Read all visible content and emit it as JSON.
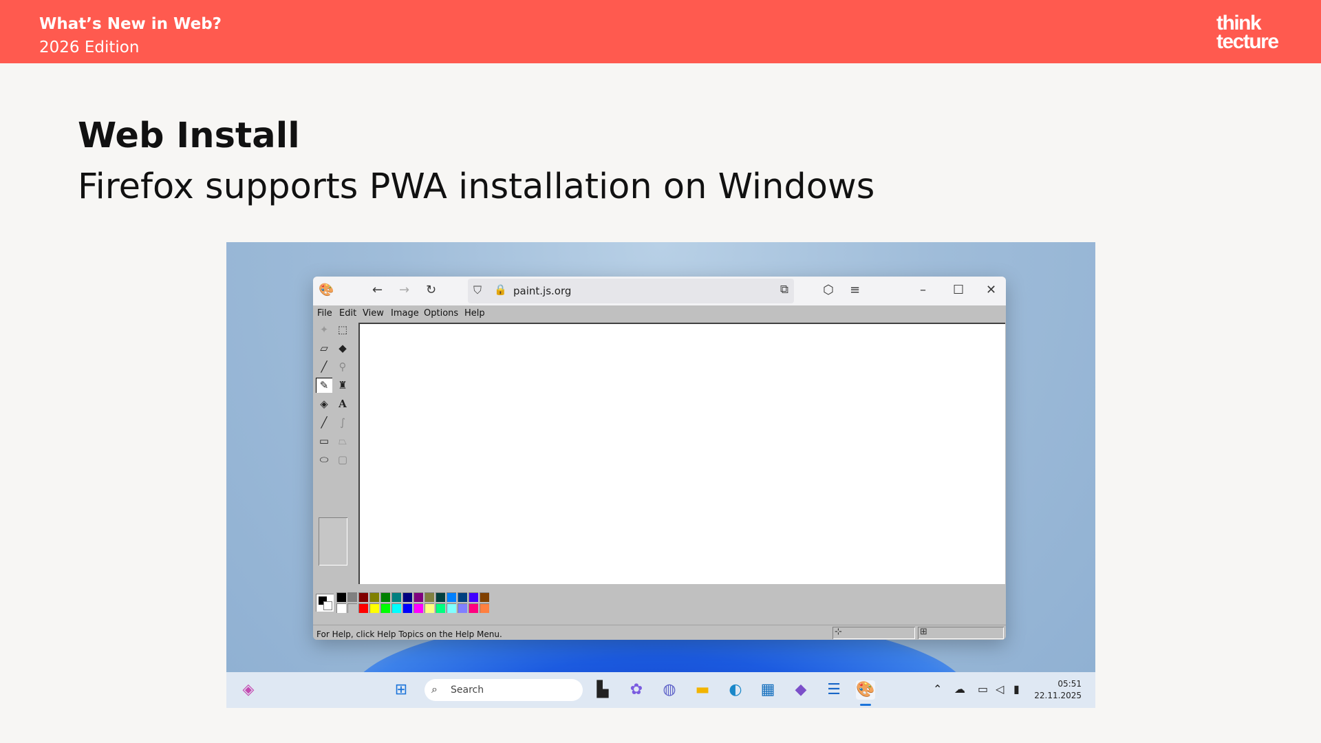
{
  "header": {
    "line1": "What’s New in Web?",
    "line2": "2026 Edition",
    "logo_line1": "think",
    "logo_line2": "tecture"
  },
  "slide": {
    "title": "Web Install",
    "subtitle": "Firefox supports PWA installation on Windows"
  },
  "browser": {
    "url": "paint.js.org"
  },
  "paint": {
    "menu": [
      "File",
      "Edit",
      "View",
      "Image",
      "Options",
      "Help"
    ],
    "status": "For Help, click Help Topics on the Help Menu.",
    "palette_top": [
      "#000000",
      "#808080",
      "#800000",
      "#808000",
      "#008000",
      "#008080",
      "#000080",
      "#800080",
      "#808040",
      "#004040",
      "#0080ff",
      "#004080",
      "#4000ff",
      "#804000"
    ],
    "palette_bottom": [
      "#ffffff",
      "#c0c0c0",
      "#ff0000",
      "#ffff00",
      "#00ff00",
      "#00ffff",
      "#0000ff",
      "#ff00ff",
      "#ffff80",
      "#00ff80",
      "#80ffff",
      "#8080ff",
      "#ff0080",
      "#ff8040"
    ]
  },
  "taskbar": {
    "search_placeholder": "Search",
    "time": "05:51",
    "date": "22.11.2025"
  },
  "colors": {
    "accent": "#ff5a4f"
  }
}
